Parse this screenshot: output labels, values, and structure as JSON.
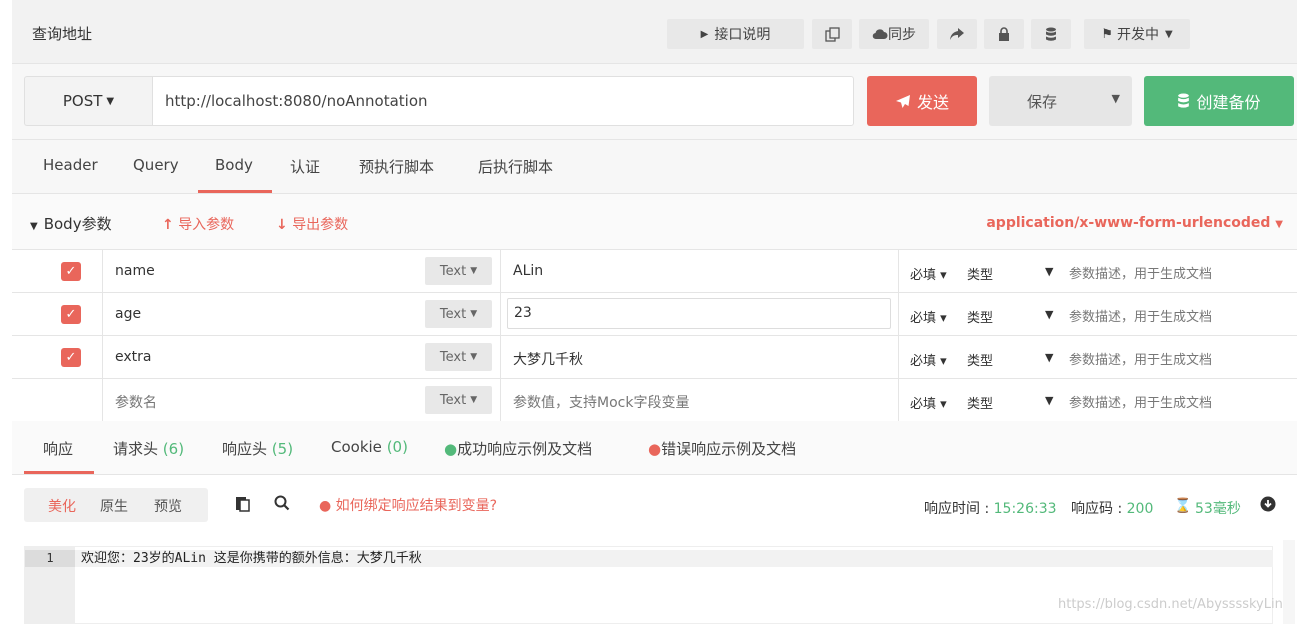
{
  "top_bar": {
    "title": "查询地址",
    "buttons": {
      "api_doc": "接口说明",
      "sync": "同步",
      "status": "开发中"
    }
  },
  "request": {
    "method": "POST",
    "url": "http://localhost:8080/noAnnotation",
    "send_label": "发送",
    "save_label": "保存",
    "backup_label": "创建备份"
  },
  "request_tabs": [
    "Header",
    "Query",
    "Body",
    "认证",
    "预执行脚本",
    "后执行脚本"
  ],
  "body_section": {
    "title": "Body参数",
    "import_label": "导入参数",
    "export_label": "导出参数",
    "content_type": "application/x-www-form-urlencoded"
  },
  "params": [
    {
      "name": "name",
      "type": "Text",
      "value": "ALin",
      "required": "必填",
      "kind": "类型",
      "desc": "参数描述，用于生成文档"
    },
    {
      "name": "age",
      "type": "Text",
      "value": "23",
      "required": "必填",
      "kind": "类型",
      "desc": "参数描述，用于生成文档"
    },
    {
      "name": "extra",
      "type": "Text",
      "value": "大梦几千秋",
      "required": "必填",
      "kind": "类型",
      "desc": "参数描述，用于生成文档"
    },
    {
      "name_placeholder": "参数名",
      "type": "Text",
      "value_placeholder": "参数值，支持Mock字段变量",
      "required": "必填",
      "kind": "类型",
      "desc": "参数描述，用于生成文档"
    }
  ],
  "response_tabs": {
    "response": "响应",
    "req_headers": "请求头",
    "req_headers_count": "(6)",
    "resp_headers": "响应头",
    "resp_headers_count": "(5)",
    "cookie": "Cookie",
    "cookie_count": "(0)",
    "success_doc": "成功响应示例及文档",
    "error_doc": "错误响应示例及文档"
  },
  "response_toolbar": {
    "views": [
      "美化",
      "原生",
      "预览"
    ],
    "help": "如何绑定响应结果到变量?",
    "time_label": "响应时间 :",
    "time_value": "15:26:33",
    "code_label": "响应码 :",
    "code_value": "200",
    "duration": "53毫秒"
  },
  "editor": {
    "line_number": "1",
    "content": "欢迎您：23岁的ALin 这是你携带的额外信息：大梦几千秋"
  },
  "watermark": "https://blog.csdn.net/AbysssskyLin",
  "colors": {
    "accent": "#e9665b",
    "success": "#53b97a"
  }
}
